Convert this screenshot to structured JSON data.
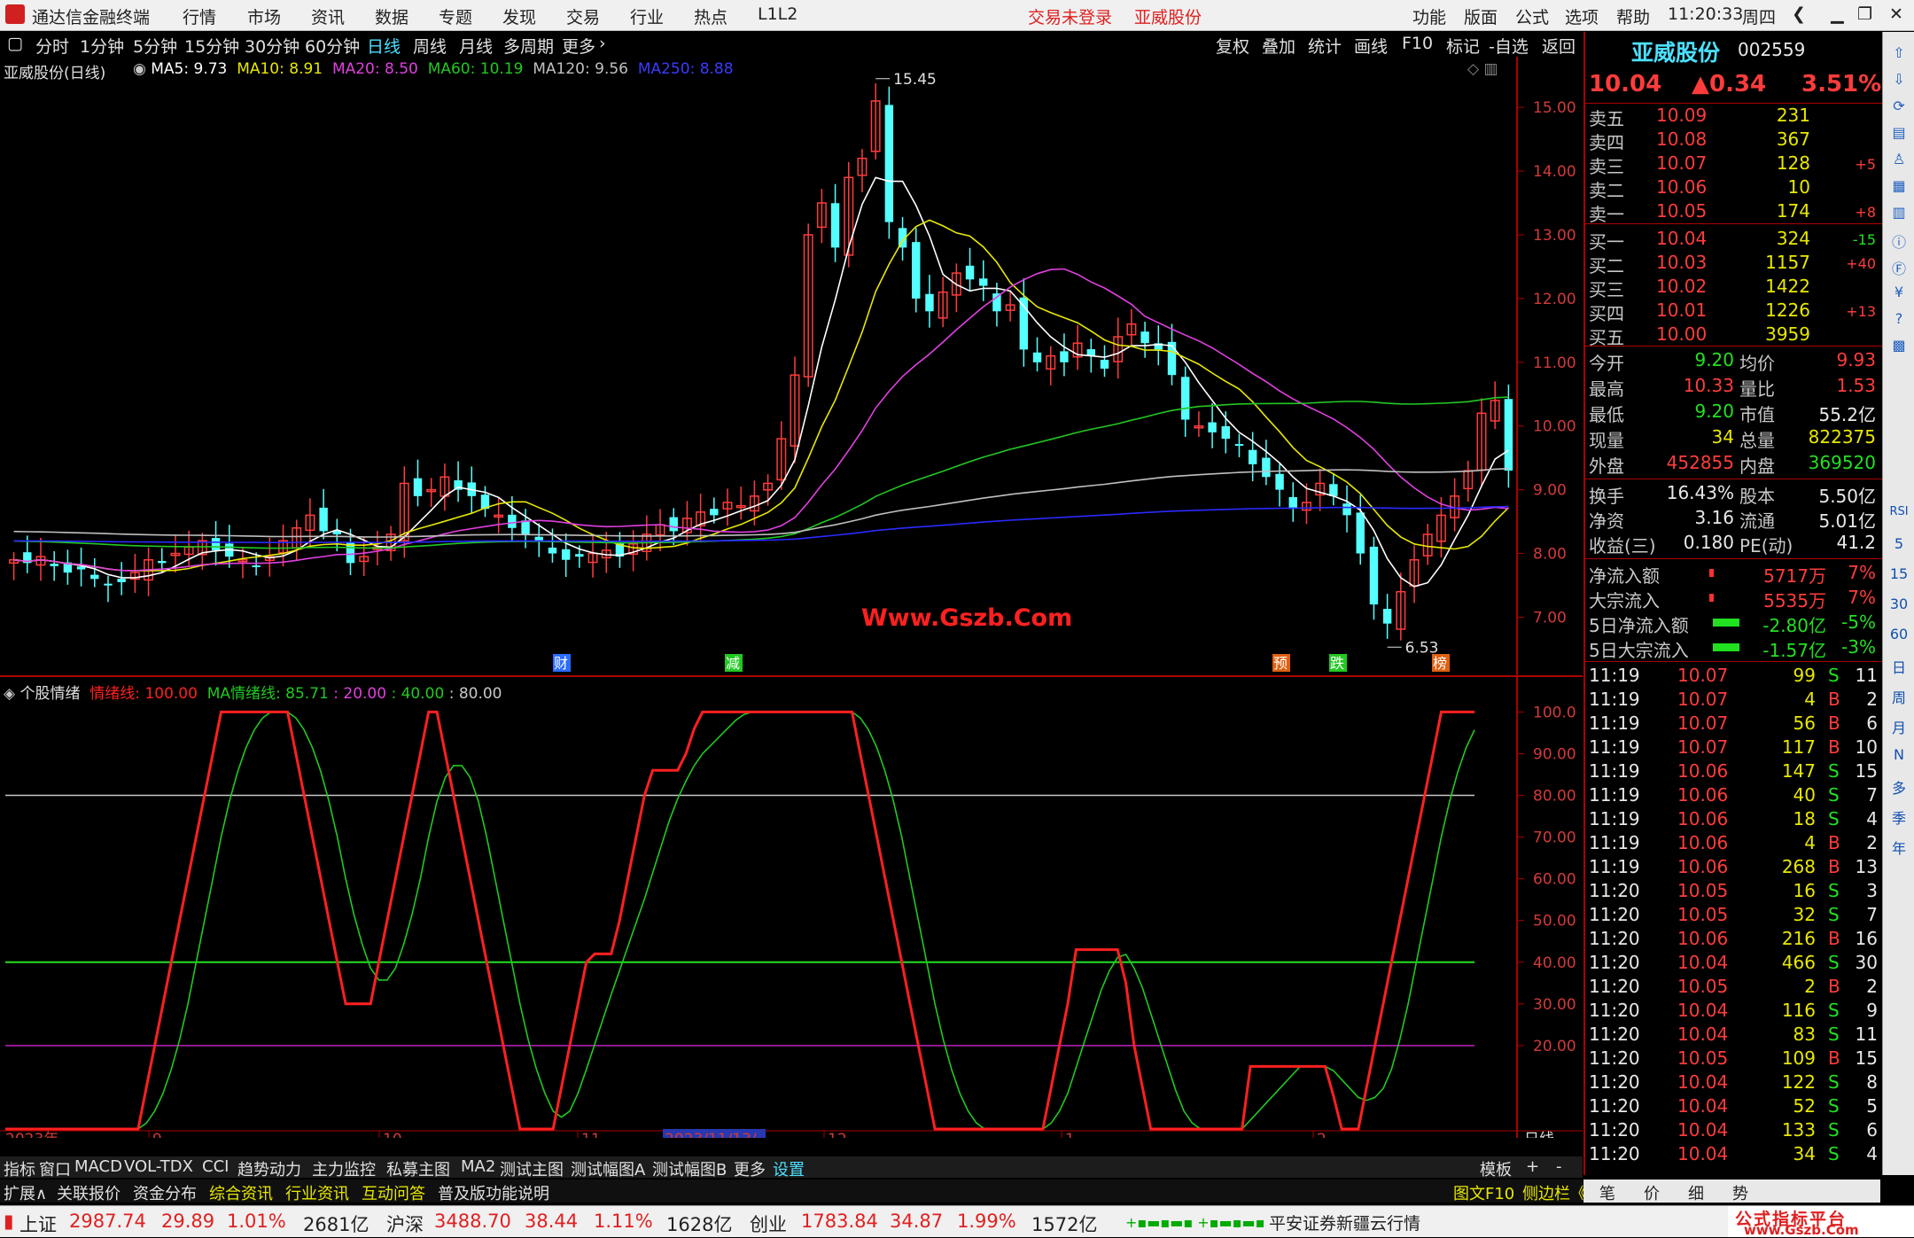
{
  "titlebar": {
    "app_name": "通达信金融终端",
    "menu": [
      "行情",
      "市场",
      "资讯",
      "数据",
      "专题",
      "发现",
      "交易",
      "行业",
      "热点",
      "L1L2"
    ],
    "login_status": "交易未登录",
    "stock_name": "亚威股份",
    "right_menu": [
      "功能",
      "版面",
      "公式",
      "选项",
      "帮助"
    ],
    "time": "11:20:33",
    "weekday": "周四"
  },
  "periods": [
    "分时",
    "1分钟",
    "5分钟",
    "15分钟",
    "30分钟",
    "60分钟",
    "日线",
    "周线",
    "月线",
    "多周期",
    "更多"
  ],
  "active_period": "日线",
  "toolbar": [
    "复权",
    "叠加",
    "统计",
    "画线",
    "F10",
    "标记",
    "-自选",
    "返回"
  ],
  "chart_data": [
    {
      "type": "candlestick",
      "title": "亚威股份(日线)",
      "ma": [
        {
          "name": "MA5",
          "value": "9.73",
          "color": "#ffffff"
        },
        {
          "name": "MA10",
          "value": "8.91",
          "color": "#e8e800"
        },
        {
          "name": "MA20",
          "value": "8.50",
          "color": "#e040e0"
        },
        {
          "name": "MA60",
          "value": "10.19",
          "color": "#22c822"
        },
        {
          "name": "MA120",
          "value": "9.56",
          "color": "#c0c0c0"
        },
        {
          "name": "MA250",
          "value": "8.88",
          "color": "#2a2aff"
        }
      ],
      "y_ticks": [
        "15.00",
        "14.00",
        "13.00",
        "12.00",
        "11.00",
        "10.00",
        "9.00",
        "8.00",
        "7.00"
      ],
      "ylim": [
        6.2,
        15.6
      ],
      "high_mark": "15.45",
      "low_mark": "6.53",
      "event_markers": [
        "财",
        "减",
        "预",
        "跌",
        "榜"
      ],
      "watermark": "Www.Gszb.Com",
      "closes": [
        7.9,
        7.85,
        7.95,
        7.8,
        7.7,
        7.75,
        7.6,
        7.5,
        7.55,
        7.7,
        7.9,
        7.85,
        8.0,
        8.1,
        8.2,
        8.05,
        7.95,
        7.9,
        7.8,
        7.95,
        8.2,
        8.4,
        8.6,
        8.35,
        8.3,
        7.85,
        7.95,
        8.1,
        8.3,
        9.1,
        8.9,
        9.0,
        9.2,
        9.0,
        8.9,
        8.7,
        8.6,
        8.4,
        8.3,
        8.2,
        8.0,
        7.9,
        7.95,
        8.0,
        8.05,
        7.95,
        8.15,
        8.3,
        8.45,
        8.35,
        8.55,
        8.65,
        8.6,
        8.8,
        8.75,
        8.9,
        9.1,
        9.8,
        10.8,
        13.0,
        13.5,
        12.8,
        13.9,
        14.2,
        15.1,
        13.2,
        12.8,
        12.0,
        11.8,
        12.1,
        12.4,
        12.3,
        12.2,
        11.8,
        11.9,
        11.2,
        11.0,
        11.1,
        11.0,
        11.3,
        11.1,
        10.9,
        11.4,
        11.6,
        11.3,
        11.2,
        10.8,
        10.1,
        10.0,
        9.9,
        9.8,
        9.7,
        9.4,
        9.2,
        9.0,
        8.7,
        8.8,
        9.1,
        8.9,
        8.6,
        8.0,
        7.2,
        6.9,
        7.4,
        7.9,
        8.3,
        8.6,
        8.9,
        9.3,
        10.2,
        10.4,
        9.3
      ],
      "ma_series_lengths": "computed"
    },
    {
      "type": "line",
      "title": "个股情绪",
      "legend": [
        {
          "name": "情绪线",
          "value": "100.00",
          "color": "#ff2020"
        },
        {
          "name": "MA情绪线",
          "value": "85.71",
          "color": "#22c822"
        },
        {
          "name": "",
          "value": "20.00",
          "color": "#e040e0"
        },
        {
          "name": "",
          "value": "40.00",
          "color": "#22c822"
        },
        {
          "name": "",
          "value": "80.00",
          "color": "#c8c8c8"
        }
      ],
      "y_ticks": [
        "100.0",
        "90.00",
        "80.00",
        "70.00",
        "60.00",
        "50.00",
        "40.00",
        "30.00",
        "20.00"
      ],
      "ylim": [
        0,
        102
      ],
      "reference_lines": [
        80,
        40,
        20
      ],
      "emotion": [
        0,
        0,
        0,
        0,
        0,
        0,
        0,
        0,
        0,
        0,
        0,
        0,
        0,
        0,
        0,
        0,
        0,
        10,
        20,
        30,
        40,
        50,
        60,
        70,
        80,
        90,
        100,
        100,
        100,
        100,
        100,
        100,
        100,
        100,
        100,
        90,
        80,
        70,
        60,
        50,
        40,
        30,
        30,
        30,
        30,
        40,
        50,
        60,
        70,
        80,
        90,
        100,
        100,
        90,
        80,
        70,
        60,
        50,
        40,
        30,
        20,
        10,
        0,
        0,
        0,
        0,
        0,
        10,
        20,
        30,
        40,
        42,
        42,
        42,
        50,
        60,
        70,
        80,
        86,
        86,
        86,
        86,
        90,
        96,
        100,
        100,
        100,
        100,
        100,
        100,
        100,
        100,
        100,
        100,
        100,
        100,
        100,
        100,
        100,
        100,
        100,
        100,
        100,
        90,
        80,
        70,
        60,
        50,
        40,
        30,
        20,
        10,
        0,
        0,
        0,
        0,
        0,
        0,
        0,
        0,
        0,
        0,
        0,
        0,
        0,
        0,
        10,
        20,
        30,
        43,
        43,
        43,
        43,
        43,
        43,
        35,
        20,
        10,
        0,
        0,
        0,
        0,
        0,
        0,
        0,
        0,
        0,
        0,
        0,
        0,
        15,
        15,
        15,
        15,
        15,
        15,
        15,
        15,
        15,
        15,
        8,
        0,
        0,
        0,
        10,
        20,
        30,
        40,
        50,
        60,
        70,
        80,
        90,
        100,
        100,
        100,
        100,
        100
      ],
      "x_labels": [
        "2023年",
        "9",
        "10",
        "11",
        "2023/11/13/—",
        "12",
        "1",
        "2",
        "日线"
      ]
    }
  ],
  "quote": {
    "name": "亚威股份",
    "code": "002559",
    "price": "10.04",
    "change": "▲0.34",
    "pct": "3.51%",
    "sell": [
      {
        "label": "卖五",
        "price": "10.09",
        "vol": "231",
        "delta": ""
      },
      {
        "label": "卖四",
        "price": "10.08",
        "vol": "367",
        "delta": ""
      },
      {
        "label": "卖三",
        "price": "10.07",
        "vol": "128",
        "delta": "+5"
      },
      {
        "label": "卖二",
        "price": "10.06",
        "vol": "10",
        "delta": ""
      },
      {
        "label": "卖一",
        "price": "10.05",
        "vol": "174",
        "delta": "+8"
      }
    ],
    "buy": [
      {
        "label": "买一",
        "price": "10.04",
        "vol": "324",
        "delta": "-15"
      },
      {
        "label": "买二",
        "price": "10.03",
        "vol": "1157",
        "delta": "+40"
      },
      {
        "label": "买三",
        "price": "10.02",
        "vol": "1422",
        "delta": ""
      },
      {
        "label": "买四",
        "price": "10.01",
        "vol": "1226",
        "delta": "+13"
      },
      {
        "label": "买五",
        "price": "10.00",
        "vol": "3959",
        "delta": ""
      }
    ],
    "stats": [
      {
        "l1": "今开",
        "v1": "9.20",
        "c1": "grn",
        "l2": "均价",
        "v2": "9.93",
        "c2": "red"
      },
      {
        "l1": "最高",
        "v1": "10.33",
        "c1": "red",
        "l2": "量比",
        "v2": "1.53",
        "c2": "red"
      },
      {
        "l1": "最低",
        "v1": "9.20",
        "c1": "grn",
        "l2": "市值",
        "v2": "55.2亿",
        "c2": "wht"
      },
      {
        "l1": "现量",
        "v1": "34",
        "c1": "yel",
        "l2": "总量",
        "v2": "822375",
        "c2": "yel"
      },
      {
        "l1": "外盘",
        "v1": "452855",
        "c1": "red",
        "l2": "内盘",
        "v2": "369520",
        "c2": "grn"
      }
    ],
    "stats2": [
      {
        "l1": "换手",
        "v1": "16.43%",
        "l2": "股本",
        "v2": "5.50亿"
      },
      {
        "l1": "净资",
        "v1": "3.16",
        "l2": "流通",
        "v2": "5.01亿"
      },
      {
        "l1": "收益(三)",
        "v1": "0.180",
        "l2": "PE(动)",
        "v2": "41.2"
      }
    ],
    "flows": [
      {
        "label": "净流入额",
        "value": "5717万",
        "pct": "7%",
        "color": "red"
      },
      {
        "label": "大宗流入",
        "value": "5535万",
        "pct": "7%",
        "color": "red"
      },
      {
        "label": "5日净流入额",
        "value": "-2.80亿",
        "pct": "-5%",
        "color": "grn"
      },
      {
        "label": "5日大宗流入",
        "value": "-1.57亿",
        "pct": "-3%",
        "color": "grn"
      }
    ],
    "ticks": [
      {
        "t": "11:19",
        "p": "10.07",
        "v": "99",
        "bs": "S",
        "n": "11"
      },
      {
        "t": "11:19",
        "p": "10.07",
        "v": "4",
        "bs": "B",
        "n": "2"
      },
      {
        "t": "11:19",
        "p": "10.07",
        "v": "56",
        "bs": "B",
        "n": "6"
      },
      {
        "t": "11:19",
        "p": "10.07",
        "v": "117",
        "bs": "B",
        "n": "10"
      },
      {
        "t": "11:19",
        "p": "10.06",
        "v": "147",
        "bs": "S",
        "n": "15"
      },
      {
        "t": "11:19",
        "p": "10.06",
        "v": "40",
        "bs": "S",
        "n": "7"
      },
      {
        "t": "11:19",
        "p": "10.06",
        "v": "18",
        "bs": "S",
        "n": "4"
      },
      {
        "t": "11:19",
        "p": "10.06",
        "v": "4",
        "bs": "B",
        "n": "2"
      },
      {
        "t": "11:19",
        "p": "10.06",
        "v": "268",
        "bs": "B",
        "n": "13"
      },
      {
        "t": "11:20",
        "p": "10.05",
        "v": "16",
        "bs": "S",
        "n": "3"
      },
      {
        "t": "11:20",
        "p": "10.05",
        "v": "32",
        "bs": "S",
        "n": "7"
      },
      {
        "t": "11:20",
        "p": "10.06",
        "v": "216",
        "bs": "B",
        "n": "16"
      },
      {
        "t": "11:20",
        "p": "10.04",
        "v": "466",
        "bs": "S",
        "n": "30"
      },
      {
        "t": "11:20",
        "p": "10.05",
        "v": "2",
        "bs": "B",
        "n": "2"
      },
      {
        "t": "11:20",
        "p": "10.04",
        "v": "116",
        "bs": "S",
        "n": "9"
      },
      {
        "t": "11:20",
        "p": "10.04",
        "v": "83",
        "bs": "S",
        "n": "11"
      },
      {
        "t": "11:20",
        "p": "10.05",
        "v": "109",
        "bs": "B",
        "n": "15"
      },
      {
        "t": "11:20",
        "p": "10.04",
        "v": "122",
        "bs": "S",
        "n": "8"
      },
      {
        "t": "11:20",
        "p": "10.04",
        "v": "52",
        "bs": "S",
        "n": "5"
      },
      {
        "t": "11:20",
        "p": "10.04",
        "v": "133",
        "bs": "S",
        "n": "6"
      },
      {
        "t": "11:20",
        "p": "10.04",
        "v": "34",
        "bs": "S",
        "n": "4"
      }
    ]
  },
  "sidebar_icons": [
    "up-arrow-icon",
    "down-arrow-icon",
    "refresh-icon",
    "chart-icon",
    "kline-icon",
    "list-icon",
    "bar-icon",
    "info-icon",
    "f10-icon",
    "money-icon",
    "qa-icon",
    "data-icon"
  ],
  "sidebar_labels": [
    "RSI",
    "5",
    "15",
    "30",
    "60",
    "日",
    "周",
    "月",
    "N",
    "多",
    "季",
    "年"
  ],
  "tabs1": [
    "指标",
    "窗口",
    "MACD",
    "VOL-TDX",
    "CCI",
    "趋势动力",
    "主力监控",
    "私募主图",
    "MA2",
    "测试主图",
    "测试幅图A",
    "测试幅图B",
    "更多",
    "设置"
  ],
  "tabs1_right": [
    "模板",
    "+",
    "-"
  ],
  "tabs2": [
    "扩展∧",
    "关联报价",
    "资金分布",
    "综合资讯",
    "行业资讯",
    "互动问答",
    "普及版功能说明"
  ],
  "tabs2_right": [
    "图文F10",
    "侧边栏《"
  ],
  "bottom_tabs_right": [
    "笔",
    "价",
    "细",
    "势"
  ],
  "status": {
    "sh_label": "上证",
    "sh_val": "2987.74",
    "sh_chg": "29.89",
    "sh_pct": "1.01%",
    "sh_amt": "2681亿",
    "hs_label": "沪深",
    "hs_val": "3488.70",
    "hs_chg": "38.44",
    "hs_pct": "1.11%",
    "hs_amt": "1628亿",
    "cy_label": "创业",
    "cy_val": "1783.84",
    "cy_chg": "34.87",
    "cy_pct": "1.99%",
    "cy_amt": "1572亿",
    "broker": "平安证券新疆云行情",
    "brand": "公式指标平台",
    "brand_url": "www.Gszb.Com"
  }
}
